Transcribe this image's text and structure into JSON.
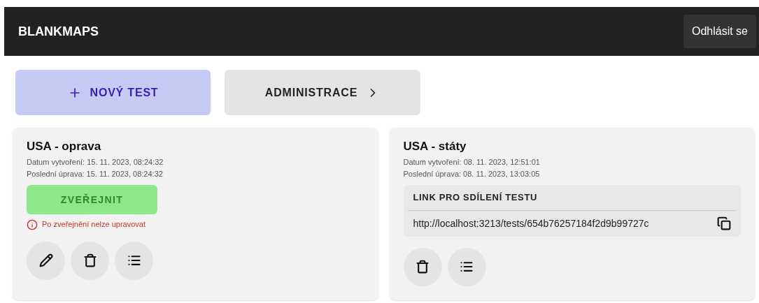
{
  "header": {
    "title": "BLANKMAPS",
    "logout": "Odhlásit se"
  },
  "toolbar": [
    {
      "kind": "new",
      "label": "NOVÝ TEST"
    },
    {
      "kind": "admin",
      "label": "ADMINISTRACE"
    }
  ],
  "tests": [
    {
      "kind": "draft",
      "title": "USA - oprava",
      "created": "Datum vytvoření: 15. 11. 2023, 08:24:32",
      "modified": "Poslední úprava: 15. 11. 2023, 08:24:32",
      "publish": "ZVEŘEJNIT",
      "warning": "Po zveřejnění nelze upravovat",
      "actions": [
        {
          "kind": "edit"
        },
        {
          "kind": "delete"
        },
        {
          "kind": "list"
        }
      ]
    },
    {
      "kind": "published",
      "title": "USA - státy",
      "created": "Datum vytvoření: 08. 11. 2023, 12:51:01",
      "modified": "Poslední úprava: 08. 11. 2023, 13:03:05",
      "share_heading": "LINK PRO SDÍLENÍ TESTU",
      "link": "http://localhost:3213/tests/654b76257184f2d9b99727c",
      "actions": [
        {
          "kind": "delete"
        },
        {
          "kind": "list"
        }
      ]
    }
  ]
}
